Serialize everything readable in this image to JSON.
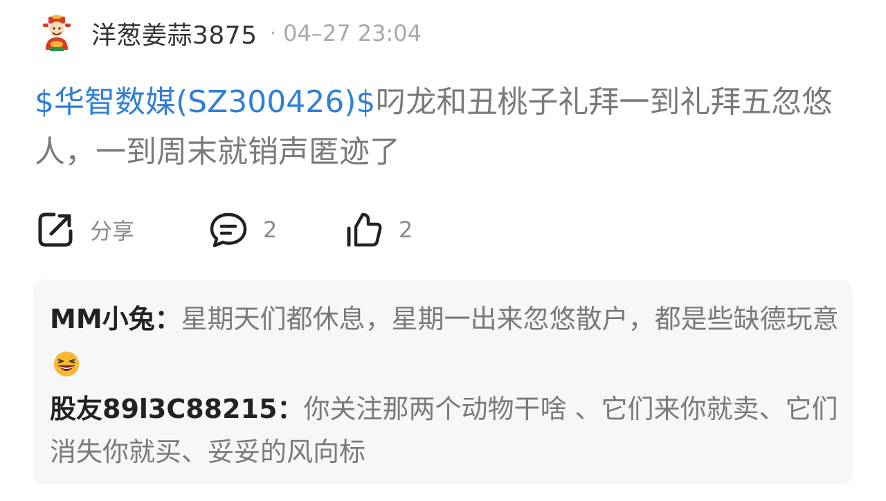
{
  "post": {
    "username": "洋葱姜蒜3875",
    "separator": "·",
    "timestamp": "04–27 23:04",
    "stock_link": "$华智数媒(SZ300426)$",
    "body_text": "叼龙和丑桃子礼拜一到礼拜五忽悠人，一到周末就销声匿迹了"
  },
  "actions": {
    "share_label": "分享",
    "comment_count": "2",
    "like_count": "2"
  },
  "comments": [
    {
      "author": "MM小兔：",
      "text": "星期天们都休息，星期一出来忽悠散户，都是些缺德玩意",
      "emoji": "laughing-emoji"
    },
    {
      "author": "股友89l3C88215：",
      "text": "你关注那两个动物干啥 、它们来你就卖、它们消失你就买、妥妥的风向标"
    }
  ],
  "colors": {
    "link_blue": "#2f7fd9",
    "comment_bg": "#f6f7f9",
    "muted_text": "#7a7a7a"
  }
}
